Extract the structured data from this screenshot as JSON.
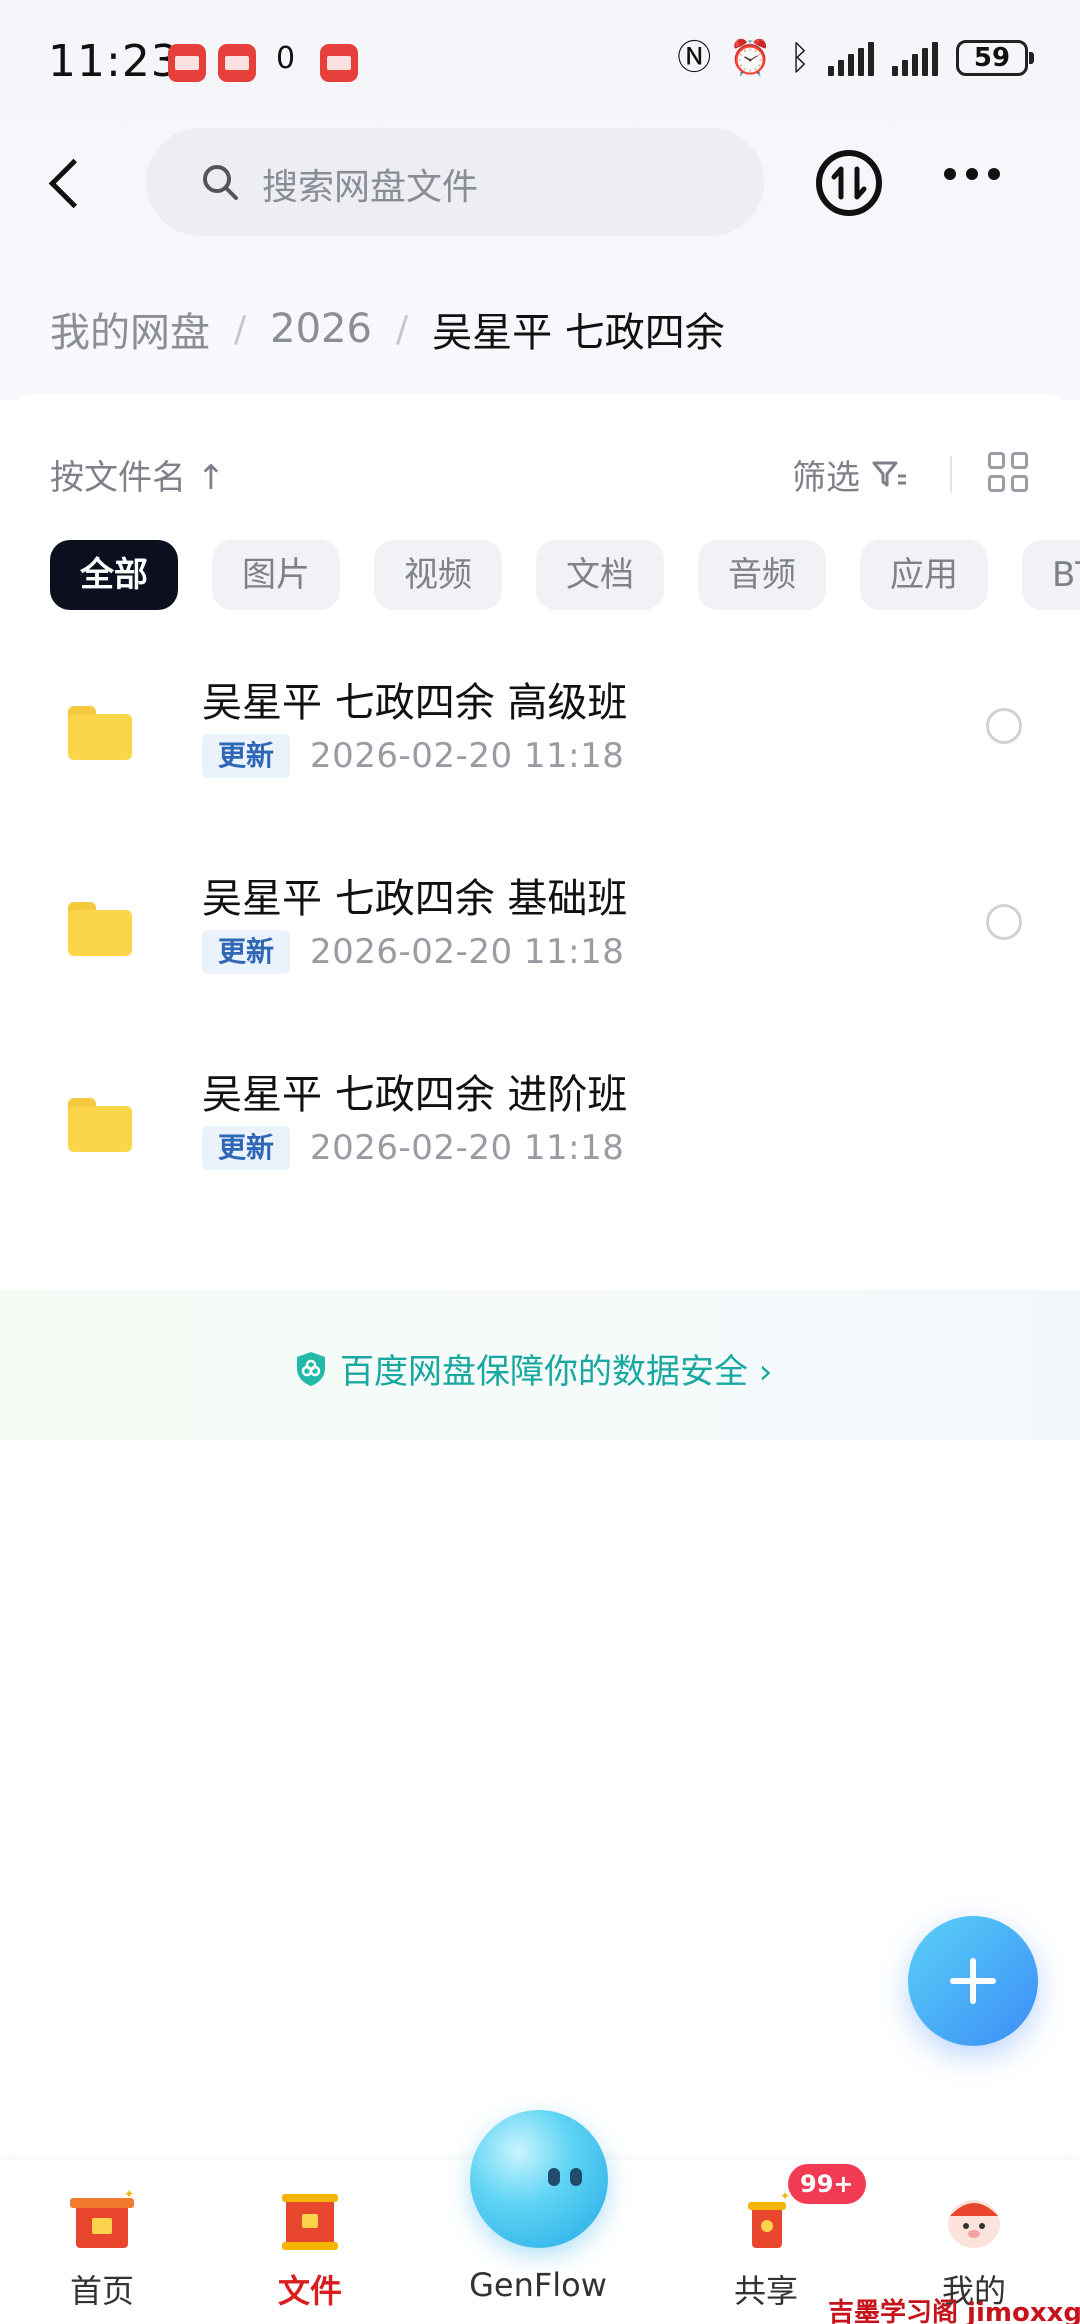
{
  "status_bar": {
    "time": "11:23",
    "battery": "59"
  },
  "header": {
    "search_placeholder": "搜索网盘文件"
  },
  "breadcrumb": {
    "items": [
      "我的网盘",
      "2026"
    ],
    "current": "吴星平 七政四余"
  },
  "toolbar": {
    "sort_label": "按文件名 ↑",
    "filter_label": "筛选"
  },
  "chips": [
    "全部",
    "图片",
    "视频",
    "文档",
    "音频",
    "应用",
    "BT"
  ],
  "files": [
    {
      "name": "吴星平 七政四余 高级班",
      "badge": "更新",
      "time": "2026-02-20  11:18"
    },
    {
      "name": "吴星平 七政四余 基础班",
      "badge": "更新",
      "time": "2026-02-20  11:18"
    },
    {
      "name": "吴星平 七政四余 进阶班",
      "badge": "更新",
      "time": "2026-02-20  11:18"
    }
  ],
  "safety_banner": "百度网盘保障你的数据安全 ›",
  "tabbar": {
    "items": [
      "首页",
      "文件",
      "GenFlow",
      "共享",
      "我的"
    ],
    "share_badge": "99+"
  },
  "watermark": "吉墨学习阁 jimoxxg.com",
  "colors": {
    "accent_red": "#d81e1e",
    "badge_blue": "#2f66b6",
    "safety_teal": "#18a8a0",
    "folder_yellow": "#fbd54a"
  }
}
